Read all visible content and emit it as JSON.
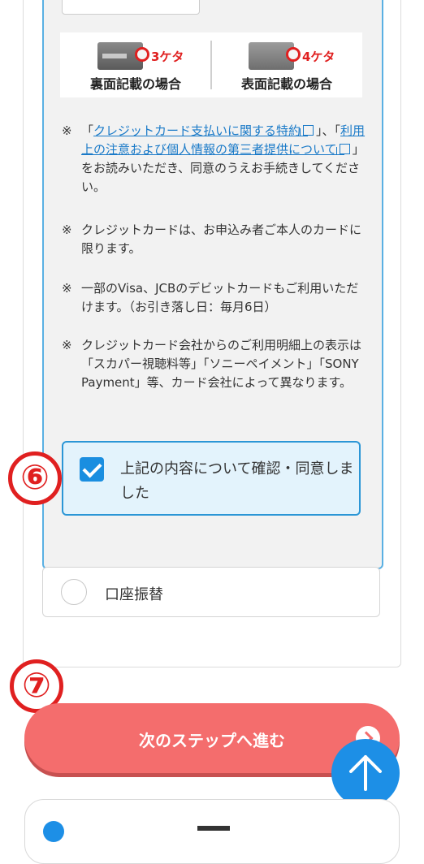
{
  "cvv_guide": {
    "back": {
      "digits": "3ケタ",
      "caption": "裏面記載の場合"
    },
    "front": {
      "digits": "4ケタ",
      "caption": "表面記載の場合"
    }
  },
  "notes": {
    "mark": "※",
    "agreement": {
      "open_quote": "「",
      "link1": "クレジットカード支払いに関する特約",
      "mid": "」、「",
      "link2": "利用上の注意および個人情報の第三者提供について",
      "end": "」をお読みいただき、同意のうえお手続きしてください。"
    },
    "n2": "クレジットカードは、お申込み者ご本人のカードに限ります。",
    "n3": "一部のVisa、JCBのデビットカードもご利用いただけます。（お引き落し日：毎月6日）",
    "n4": "クレジットカード会社からのご利用明細上の表示は「スカパー視聴料等」「ソニーペイメント」「SONY Payment」等、カード会社によって異なります。"
  },
  "consent": {
    "label": "上記の内容について確認・同意しました",
    "checked": true
  },
  "payment_options": {
    "bank_transfer": "口座振替"
  },
  "step_markers": {
    "six": "⑥",
    "seven": "⑦"
  },
  "next_button": {
    "label": "次のステップへ進む"
  },
  "colors": {
    "accent_blue": "#1d8fe6",
    "next_red": "#f46d6d",
    "marker_red": "#e02020"
  },
  "icons": {
    "scroll_top": "arrow-up-icon",
    "next": "chevron-right-icon",
    "external": "external-link-icon"
  }
}
